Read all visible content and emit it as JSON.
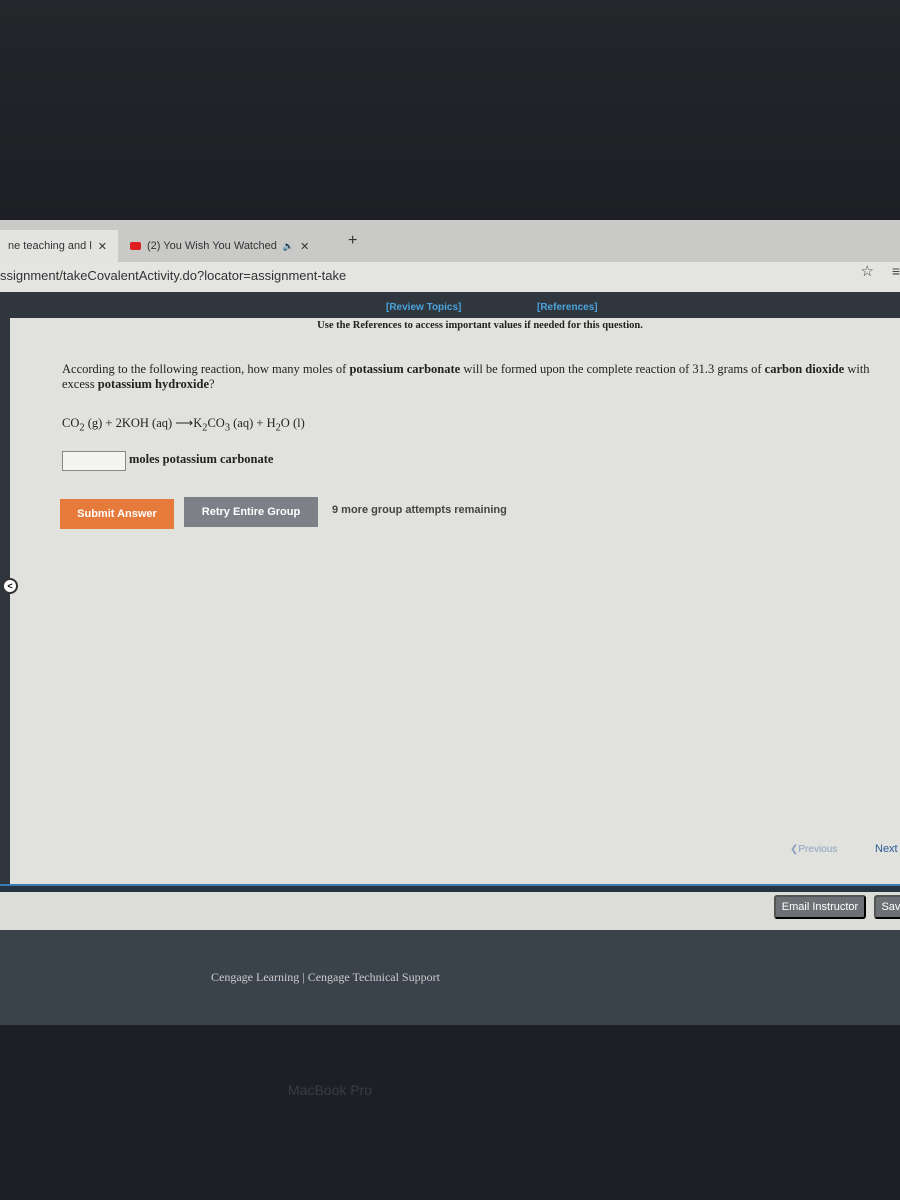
{
  "browser": {
    "tabs": [
      {
        "label": "ne teaching and l"
      },
      {
        "label": "(2) You Wish You Watched",
        "audio": "🔈"
      }
    ],
    "close": "✕",
    "new_tab": "+",
    "url": "ssignment/takeCovalentActivity.do?locator=assignment-take",
    "star": "☆",
    "menu": "≡"
  },
  "header": {
    "review_topics": "[Review Topics]",
    "references": "[References]",
    "instruction": "Use the References to access important values if needed for this question."
  },
  "question": {
    "p1": "According to the following reaction, how many moles of ",
    "b1": "potassium carbonate",
    "p2": " will be formed upon the complete reaction of 31.3 grams of ",
    "b2": "carbon dioxide",
    "p3": " with excess ",
    "b3": "potassium hydroxide",
    "p4": "?",
    "equation": {
      "r1": "CO",
      "r1s": "2",
      "r1p": " (g) + 2KOH (aq) ⟶K",
      "p1s": "2",
      "p1b": "CO",
      "p1s2": "3",
      "p1p": " (aq) + H",
      "p2s": "2",
      "p2p": "O (l)"
    },
    "answer_value": "",
    "answer_label": "moles potassium carbonate"
  },
  "actions": {
    "submit": "Submit Answer",
    "retry": "Retry Entire Group",
    "attempts": "9 more group attempts remaining"
  },
  "nav": {
    "previous": "Previous",
    "next": "Next"
  },
  "toolbar": {
    "email": "Email Instructor",
    "save": "Save"
  },
  "footer": {
    "cengage": "Cengage Learning",
    "sep": "|",
    "support": "Cengage Technical Support"
  },
  "device": "MacBook Pro",
  "colors": {
    "submit": "#e57a3b",
    "retry": "#7d8187",
    "link": "#4aa3dc",
    "navbar": "#30363e"
  }
}
